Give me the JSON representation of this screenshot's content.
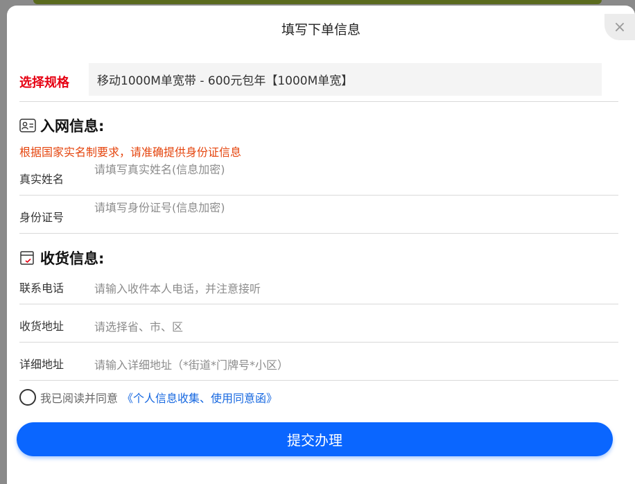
{
  "modal": {
    "title": "填写下单信息",
    "close_symbol": "×"
  },
  "spec": {
    "label": "选择规格",
    "value": "移动1000M单宽带 - 600元包年【1000M单宽】"
  },
  "network_section": {
    "title": "入网信息:",
    "icon": "id-card-icon",
    "notice": "根据国家实名制要求，请准确提供身份证信息",
    "fields": [
      {
        "label": "真实姓名",
        "placeholder": "请填写真实姓名(信息加密)"
      },
      {
        "label": "身份证号",
        "placeholder": "请填写身份证号(信息加密)"
      }
    ]
  },
  "shipping_section": {
    "title": "收货信息:",
    "icon": "address-form-icon",
    "fields": [
      {
        "label": "联系电话",
        "placeholder": "请输入收件本人电话，并注意接听"
      },
      {
        "label": "收货地址",
        "placeholder": "请选择省、市、区"
      },
      {
        "label": "详细地址",
        "placeholder": "请输入详细地址（*街道*门牌号*小区）"
      }
    ]
  },
  "agreement": {
    "text": "我已阅读并同意",
    "link": "《个人信息收集、使用同意函》"
  },
  "submit": {
    "label": "提交办理"
  },
  "colors": {
    "accent": "#0a66ff",
    "spec_label": "#e60012",
    "notice": "#e5450e",
    "link": "#1768e0"
  }
}
